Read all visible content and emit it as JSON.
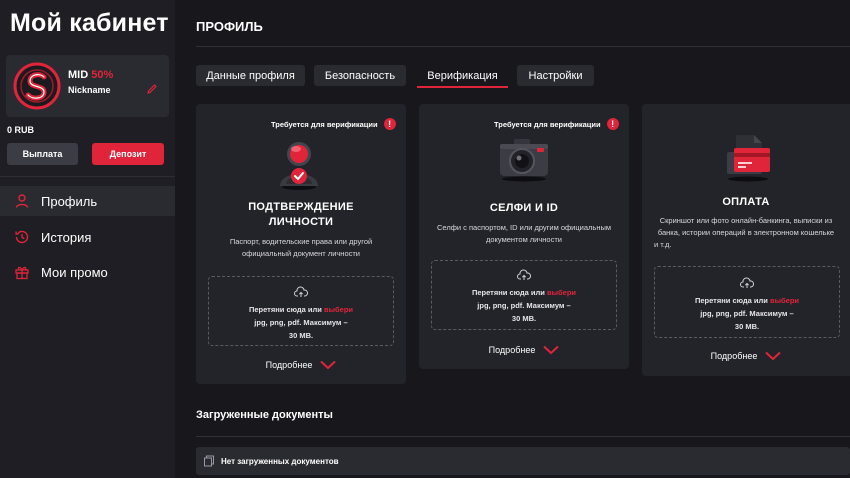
{
  "sidebar": {
    "title": "Мой кабинет",
    "user": {
      "level_name": "MID",
      "level_percent": "50%",
      "nickname": "Nickname"
    },
    "balance": "0 RUB",
    "withdraw_label": "Выплата",
    "deposit_label": "Депозит",
    "nav": [
      {
        "label": "Профиль",
        "icon": "user-icon",
        "active": true
      },
      {
        "label": "История",
        "icon": "history-icon",
        "active": false
      },
      {
        "label": "Мои промо",
        "icon": "gift-icon",
        "active": false
      }
    ]
  },
  "main": {
    "title": "ПРОФИЛЬ",
    "tabs": [
      {
        "label": "Данные профиля",
        "active": false
      },
      {
        "label": "Безопасность",
        "active": false
      },
      {
        "label": "Верификация",
        "active": true
      },
      {
        "label": "Настройки",
        "active": false
      }
    ],
    "cards": [
      {
        "required": "Требуется для верификации",
        "icon": "user-check-icon",
        "title_line1": "ПОДТВЕРЖДЕНИЕ",
        "title_line2": "ЛИЧНОСТИ",
        "desc_line1": "Паспорт, водительские права или другой",
        "desc_line2": "официальный документ личности",
        "desc_line3": "",
        "drop_prefix": "Перетяни сюда или ",
        "drop_pick": "выбери",
        "drop_line2": "jpg, png, pdf. Максимум –",
        "drop_line3": "30 MB.",
        "more": "Подробнее"
      },
      {
        "required": "Требуется для верификации",
        "icon": "camera-icon",
        "title_line1": "СЕЛФИ И ID",
        "title_line2": "",
        "desc_line1": "Селфи с паспортом, ID или другим официальным",
        "desc_line2": "документом личности",
        "desc_line3": "",
        "drop_prefix": "Перетяни сюда или ",
        "drop_pick": "выбери",
        "drop_line2": "jpg, png, pdf. Максимум –",
        "drop_line3": "30 MB.",
        "more": "Подробнее"
      },
      {
        "required": "",
        "icon": "payment-card-icon",
        "title_line1": "ОПЛАТА",
        "title_line2": "",
        "desc_line1": "Скриншот или фото онлайн-банкинга, выписки из",
        "desc_line2": "банка, истории операций в электронном кошельке",
        "desc_line3": "и т.д.",
        "drop_prefix": "Перетяни сюда или ",
        "drop_pick": "выбери",
        "drop_line2": "jpg, png, pdf. Максимум –",
        "drop_line3": "30 MB.",
        "more": "Подробнее"
      }
    ],
    "docs_title": "Загруженные документы",
    "docs_empty": "Нет загруженных документов"
  },
  "colors": {
    "accent": "#e0253a",
    "background": "#17171c",
    "sidebar": "#1e1e24",
    "card": "#23232a"
  }
}
